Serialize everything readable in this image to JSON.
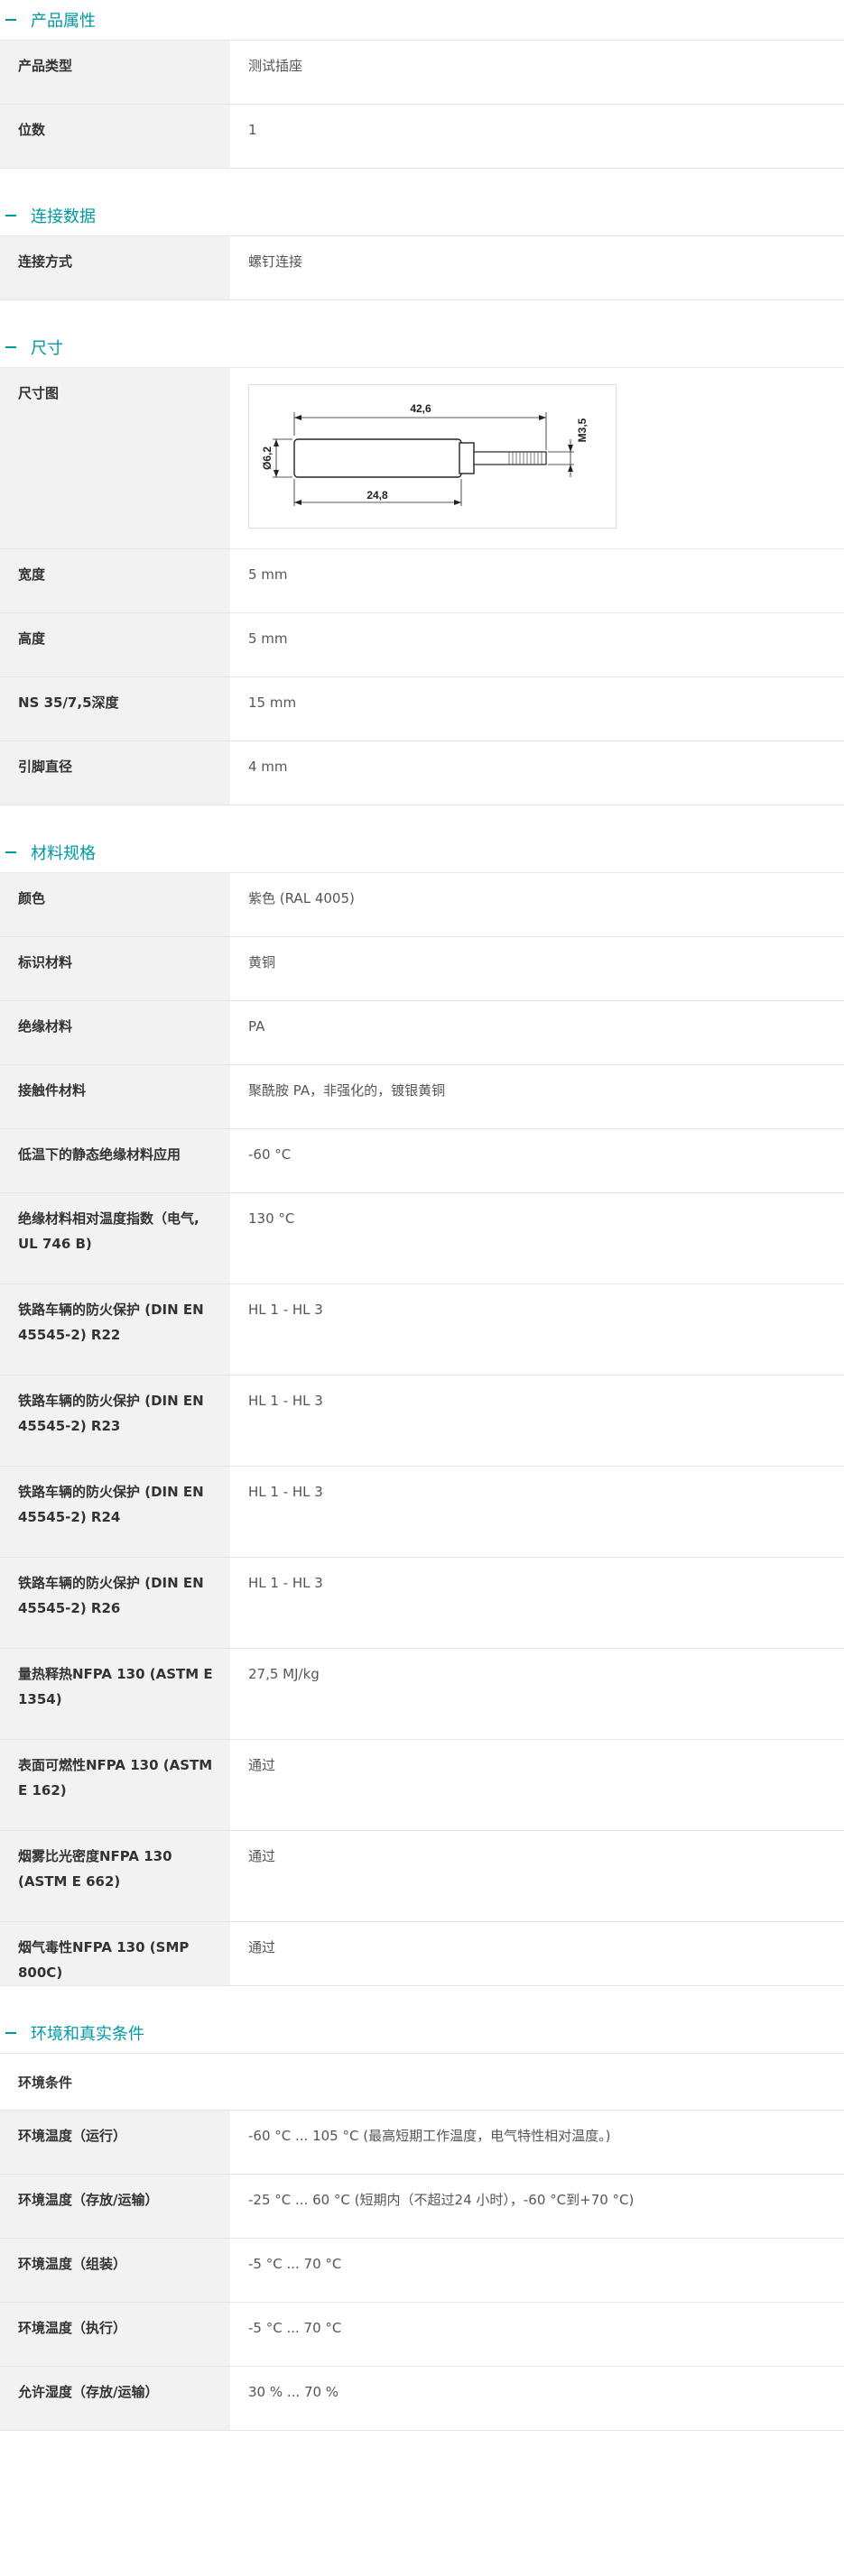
{
  "sections": {
    "product": {
      "title": "产品属性",
      "rows": [
        {
          "label": "产品类型",
          "value": "测试插座"
        },
        {
          "label": "位数",
          "value": "1"
        }
      ]
    },
    "connection": {
      "title": "连接数据",
      "rows": [
        {
          "label": "连接方式",
          "value": "螺钉连接"
        }
      ]
    },
    "dimensions": {
      "title": "尺寸",
      "drawing_label": "尺寸图",
      "drawing": {
        "dim_top": "42,6",
        "dim_bottom": "24,8",
        "dim_left": "Ø6,2",
        "dim_right": "M3,5"
      },
      "rows": [
        {
          "label": "宽度",
          "value": "5 mm"
        },
        {
          "label": "高度",
          "value": "5 mm"
        },
        {
          "label": "NS 35/7,5深度",
          "value": "15 mm"
        },
        {
          "label": "引脚直径",
          "value": "4 mm"
        }
      ]
    },
    "material": {
      "title": "材料规格",
      "rows": [
        {
          "label": "颜色",
          "value": "紫色 (RAL 4005)"
        },
        {
          "label": "标识材料",
          "value": "黄铜"
        },
        {
          "label": "绝缘材料",
          "value": "PA"
        },
        {
          "label": "接触件材料",
          "value": "聚酰胺 PA，非强化的，镀银黄铜"
        },
        {
          "label": "低温下的静态绝缘材料应用",
          "value": "-60 °C"
        },
        {
          "label": "绝缘材料相对温度指数（电气, UL 746 B)",
          "value": "130 °C"
        },
        {
          "label": "铁路车辆的防火保护 (DIN EN 45545-2) R22",
          "value": "HL 1 - HL 3"
        },
        {
          "label": "铁路车辆的防火保护 (DIN EN 45545-2) R23",
          "value": "HL 1 - HL 3"
        },
        {
          "label": "铁路车辆的防火保护 (DIN EN 45545-2) R24",
          "value": "HL 1 - HL 3"
        },
        {
          "label": "铁路车辆的防火保护 (DIN EN 45545-2) R26",
          "value": "HL 1 - HL 3"
        },
        {
          "label": "量热释热NFPA 130 (ASTM E 1354)",
          "value": "27,5 MJ/kg"
        },
        {
          "label": "表面可燃性NFPA 130 (ASTM E 162)",
          "value": "通过"
        },
        {
          "label": "烟雾比光密度NFPA 130 (ASTM E 662)",
          "value": "通过"
        },
        {
          "label": "烟气毒性NFPA 130 (SMP 800C)",
          "value": "通过"
        }
      ]
    },
    "environment": {
      "title": "环境和真实条件",
      "subheading": "环境条件",
      "rows": [
        {
          "label": "环境温度（运行）",
          "value": "-60 °C ... 105 °C (最高短期工作温度，电气特性相对温度。)"
        },
        {
          "label": "环境温度（存放/运输）",
          "value": "-25 °C ... 60 °C (短期内（不超过24 小时），-60 °C到+70 °C)"
        },
        {
          "label": "环境温度（组装）",
          "value": "-5 °C ... 70 °C"
        },
        {
          "label": "环境温度（执行）",
          "value": "-5 °C ... 70 °C"
        },
        {
          "label": "允许湿度（存放/运输）",
          "value": "30 % ... 70 %"
        }
      ]
    }
  }
}
